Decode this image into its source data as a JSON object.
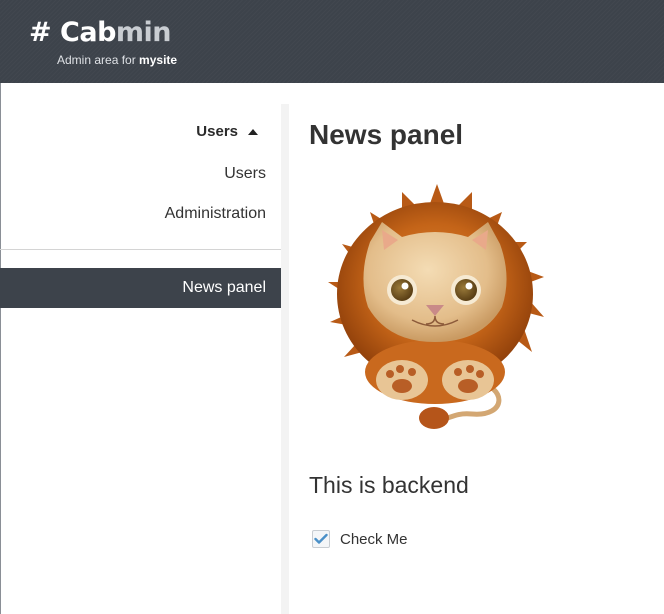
{
  "header": {
    "brand_hash": "#",
    "brand_part1": "Cab",
    "brand_part2": "min",
    "subtitle_prefix": "Admin area for",
    "site_name": "mysite"
  },
  "sidebar": {
    "group_label": "Users",
    "items": [
      {
        "label": "Users"
      },
      {
        "label": "Administration"
      }
    ],
    "active_item": "News panel"
  },
  "main": {
    "title": "News panel",
    "image_icon": "lion-mascot-icon",
    "backend_text": "This is backend",
    "checkbox": {
      "label": "Check Me",
      "checked": true
    }
  },
  "colors": {
    "header_bg": "#3d434b",
    "active_bg": "#3d434b",
    "check_accent": "#4a90c8"
  }
}
